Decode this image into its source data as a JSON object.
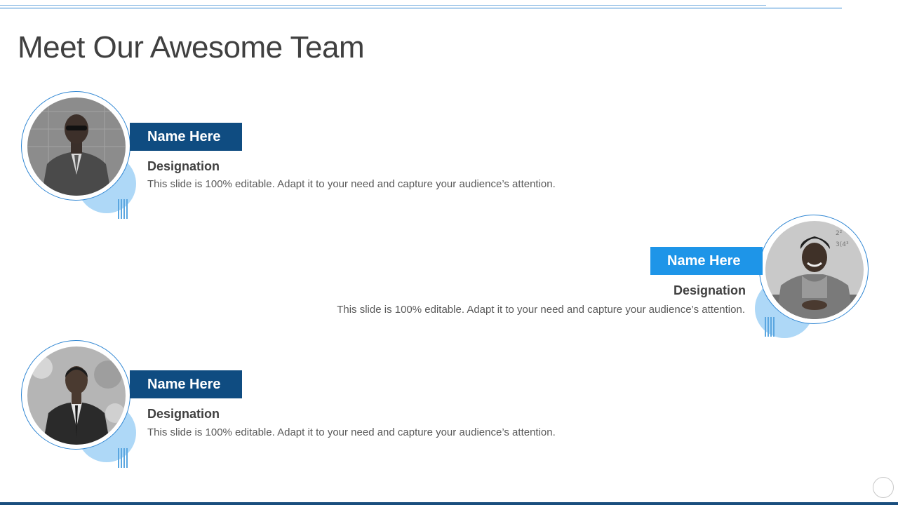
{
  "slide": {
    "title": "Meet Our Awesome Team"
  },
  "colors": {
    "primary_dark": "#0f4c81",
    "primary_light": "#1e95e8",
    "accent_circle": "#aed8f7",
    "text_dark": "#404040",
    "text_muted": "#595959"
  },
  "team": [
    {
      "name": "Name Here",
      "designation": "Designation",
      "description": "This slide is 100% editable. Adapt it to your need and capture your audience’s attention.",
      "photo": "man-in-suit-sunglasses-photo"
    },
    {
      "name": "Name Here",
      "designation": "Designation",
      "description": "This slide is 100% editable. Adapt it to your need and capture your audience’s attention.",
      "photo": "smiling-woman-at-desk-photo"
    },
    {
      "name": "Name Here",
      "designation": "Designation",
      "description": "This slide is 100% editable. Adapt it to your need and capture your audience’s attention.",
      "photo": "man-in-suit-and-tie-photo"
    }
  ]
}
